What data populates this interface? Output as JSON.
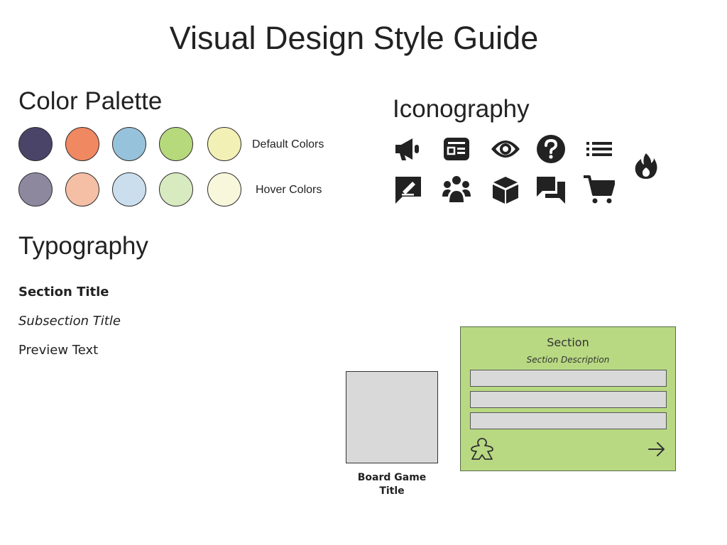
{
  "page": {
    "title": "Visual Design Style Guide"
  },
  "color_palette": {
    "heading": "Color Palette",
    "default_label": "Default Colors",
    "hover_label": "Hover Colors",
    "default_colors": [
      "#4a4468",
      "#f08862",
      "#97c2dc",
      "#b6d97c",
      "#f2f0b4"
    ],
    "hover_colors": [
      "#8e889f",
      "#f5bfa6",
      "#cbdeed",
      "#d7eac0",
      "#f8f7dc"
    ]
  },
  "iconography": {
    "heading": "Iconography",
    "icons": [
      "megaphone-icon",
      "newspaper-icon",
      "eye-icon",
      "question-circle-icon",
      "list-icon",
      "fire-icon",
      "edit-comment-icon",
      "users-icon",
      "box-icon",
      "comments-icon",
      "shopping-cart-icon"
    ]
  },
  "typography": {
    "heading": "Typography",
    "section_title": "Section Title",
    "subsection_title": "Subsection Title",
    "preview_text": "Preview Text"
  },
  "board_game": {
    "title": "Board Game Title"
  },
  "section_card": {
    "title": "Section",
    "description": "Section Description",
    "background": "#b8d982",
    "icons": [
      "meeple-icon",
      "arrow-right-icon"
    ]
  }
}
